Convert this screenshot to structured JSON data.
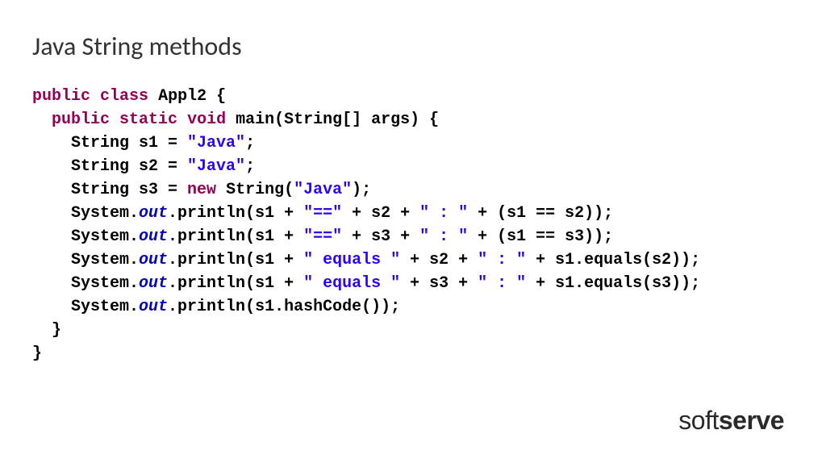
{
  "title": "Java String methods",
  "code": {
    "l1_kw1": "public",
    "l1_kw2": "class",
    "l1_cls": "Appl2 {",
    "l2_kw1": "public",
    "l2_kw2": "static",
    "l2_kw3": "void",
    "l2_rest": "main(String[] args) {",
    "l3_a": "String s1 = ",
    "l3_s": "\"Java\"",
    "l3_b": ";",
    "l4_a": "String s2 = ",
    "l4_s": "\"Java\"",
    "l4_b": ";",
    "l5_a": "String s3 = ",
    "l5_kw": "new",
    "l5_b": " String(",
    "l5_s": "\"Java\"",
    "l5_c": ");",
    "l6_a": "System.",
    "l6_f": "out",
    "l6_b": ".println(s1 + ",
    "l6_s1": "\"==\"",
    "l6_c": " + s2 + ",
    "l6_s2": "\" : \"",
    "l6_d": " + (s1 == s2));",
    "l7_a": "System.",
    "l7_f": "out",
    "l7_b": ".println(s1 + ",
    "l7_s1": "\"==\"",
    "l7_c": " + s3 + ",
    "l7_s2": "\" : \"",
    "l7_d": " + (s1 == s3));",
    "l8_a": "System.",
    "l8_f": "out",
    "l8_b": ".println(s1 + ",
    "l8_s1": "\" equals \"",
    "l8_c": " + s2 + ",
    "l8_s2": "\" : \"",
    "l8_d": " + s1.equals(s2));",
    "l9_a": "System.",
    "l9_f": "out",
    "l9_b": ".println(s1 + ",
    "l9_s1": "\" equals \"",
    "l9_c": " + s3 + ",
    "l9_s2": "\" : \"",
    "l9_d": " + s1.equals(s3));",
    "l10_a": "System.",
    "l10_f": "out",
    "l10_b": ".println(s1.hashCode());",
    "l11": "}",
    "l12": "}"
  },
  "brand": {
    "part1": "soft",
    "part2": "serve"
  }
}
